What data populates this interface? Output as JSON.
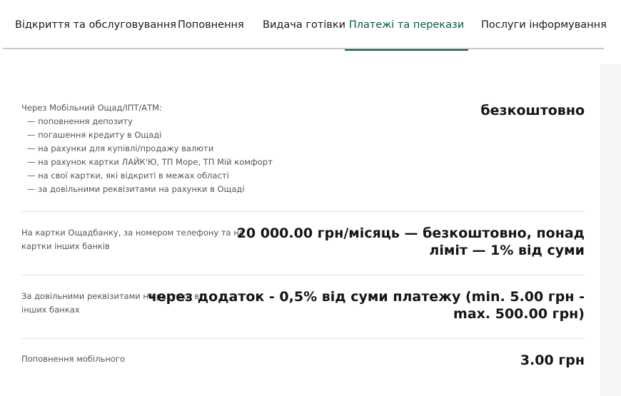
{
  "tabs": [
    {
      "label": "Відкриття та обслуговування",
      "active": false
    },
    {
      "label": "Поповнення",
      "active": false
    },
    {
      "label": "Видача готівки",
      "active": false
    },
    {
      "label": "Платежі та перекази",
      "active": true
    },
    {
      "label": "Послуги інформування",
      "active": false
    }
  ],
  "rows": [
    {
      "label": "Через Мобільний Ощад/ІПТ/АТМ:",
      "sub_items": [
        "— поповнення депозиту",
        "— погашення кредиту в Ощаді",
        "— на рахунки для купівлі/продажу валюти",
        "— на рахунок картки ЛАЙК'Ю, ТП Море, ТП Мій комфорт",
        "— на свої картки, які відкриті в межах області",
        "— за довільними реквізитами на рахунки в Ощаді"
      ],
      "value": "безкоштовно"
    },
    {
      "label_line1": "На картки Ощадбанку, за номером телефону та на",
      "label_line2": "картки інших банків",
      "value_line1": "20 000.00 грн/місяць — безкоштовно, понад",
      "value_line2": "ліміт — 1% від суми"
    },
    {
      "label_line1": "За довільними реквізитами на рахунки в",
      "label_line2": "інших банках",
      "value_line1": "через додаток - 0,5% від суми платежу (min. 5.00 грн -",
      "value_line2": "max. 500.00 грн)"
    },
    {
      "label": "Поповнення мобільного",
      "value": "3.00 грн"
    }
  ],
  "colors": {
    "accent": "#0b5a3a",
    "divider": "#e2e2e2",
    "panel_bg": "#f4f5f6"
  }
}
